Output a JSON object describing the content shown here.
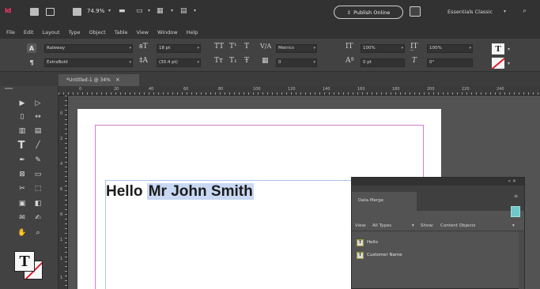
{
  "app": {
    "logo_text": "Id",
    "zoom": "74.9%",
    "publish_label": "Publish Online",
    "workspace": "Essentials Classic",
    "accent_color": "#ff3366"
  },
  "menu": [
    "File",
    "Edit",
    "Layout",
    "Type",
    "Object",
    "Table",
    "View",
    "Window",
    "Help"
  ],
  "control": {
    "font_family": "Raleway",
    "font_style": "ExtraBold",
    "font_size": "18 pt",
    "leading": "(30.4 pt)",
    "tracking": "Metrics",
    "kerning": "0",
    "vertical_scale": "100%",
    "horizontal_scale": "100%",
    "baseline_shift": "0 pt",
    "skew": "0°"
  },
  "tab": {
    "label": "*Untitled-1 @ 34%",
    "close": "×"
  },
  "ruler": {
    "h_ticks": [
      "0",
      "20",
      "40",
      "60",
      "80",
      "100",
      "120",
      "140",
      "160",
      "180",
      "200",
      "220",
      "240"
    ],
    "v_ticks": [
      "0",
      "2",
      "4",
      "6",
      "8",
      "1",
      "1",
      "1"
    ]
  },
  "page": {
    "text_plain": "Hello ",
    "text_selected": "Mr John Smith"
  },
  "panel": {
    "title": "Data Merge",
    "view_label": "View:",
    "view_value": "All Types",
    "show_label": "Show:",
    "show_value": "Content Objects",
    "items": [
      {
        "label": "Hello"
      },
      {
        "label": "Customer Name"
      }
    ]
  },
  "icons": {
    "selection": "selection-tool-icon",
    "type": "type-tool-icon",
    "fill_stroke": "fill-stroke-icon"
  }
}
